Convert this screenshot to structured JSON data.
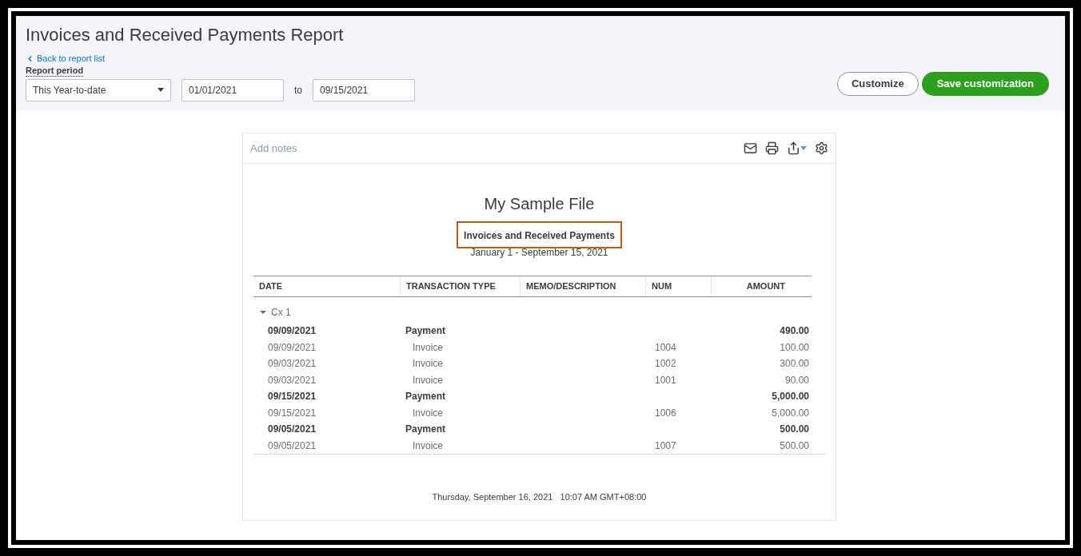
{
  "page": {
    "title": "Invoices and Received Payments Report",
    "back_link": "Back to report list",
    "period_label": "Report period"
  },
  "filters": {
    "period": "This Year-to-date",
    "from": "01/01/2021",
    "to_label": "to",
    "to": "09/15/2021"
  },
  "buttons": {
    "customize": "Customize",
    "save": "Save customization"
  },
  "report": {
    "notes_placeholder": "Add notes",
    "company": "My Sample File",
    "title": "Invoices and Received Payments",
    "title_highlighted": true,
    "range": "January 1 - September 15, 2021",
    "columns": [
      "DATE",
      "TRANSACTION TYPE",
      "MEMO/DESCRIPTION",
      "NUM",
      "AMOUNT"
    ],
    "groups": [
      {
        "name": "Cx 1",
        "expanded": true,
        "rows": [
          {
            "kind": "payment",
            "date": "09/09/2021",
            "type": "Payment",
            "num": "",
            "amount": "490.00"
          },
          {
            "kind": "invoice",
            "date": "09/09/2021",
            "type": "Invoice",
            "num": "1004",
            "amount": "100.00"
          },
          {
            "kind": "invoice",
            "date": "09/03/2021",
            "type": "Invoice",
            "num": "1002",
            "amount": "300.00"
          },
          {
            "kind": "invoice",
            "date": "09/03/2021",
            "type": "Invoice",
            "num": "1001",
            "amount": "90.00"
          },
          {
            "kind": "payment",
            "date": "09/15/2021",
            "type": "Payment",
            "num": "",
            "amount": "5,000.00"
          },
          {
            "kind": "invoice",
            "date": "09/15/2021",
            "type": "Invoice",
            "num": "1006",
            "amount": "5,000.00"
          },
          {
            "kind": "payment",
            "date": "09/05/2021",
            "type": "Payment",
            "num": "",
            "amount": "500.00"
          },
          {
            "kind": "invoice",
            "date": "09/05/2021",
            "type": "Invoice",
            "num": "1007",
            "amount": "500.00"
          }
        ]
      }
    ],
    "footer": "Thursday, September 16, 2021   10:07 AM GMT+08:00"
  }
}
